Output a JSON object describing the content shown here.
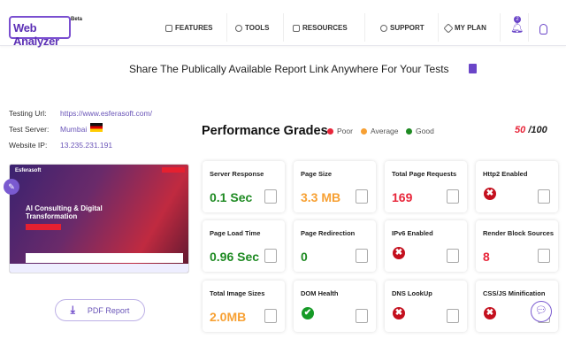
{
  "nav": {
    "logo": "Web Analyzer",
    "beta": "Beta",
    "items": [
      "FEATURES",
      "TOOLS",
      "RESOURCES",
      "SUPPORT",
      "MY PLAN"
    ],
    "notification_count": "2"
  },
  "share_text": "Share The Publically Available Report Link Anywhere For Your Tests",
  "info": {
    "url_label": "Testing Url:",
    "url": "https://www.esferasoft.com/",
    "server_label": "Test Server:",
    "server": "Mumbai",
    "ip_label": "Website IP:",
    "ip": "13.235.231.191"
  },
  "preview": {
    "brand": "Esferasoft",
    "headline": "AI Consulting & Digital Transformation"
  },
  "pdf_label": "PDF Report",
  "grades": {
    "title": "Performance Grades",
    "legend": [
      "Poor",
      "Average",
      "Good"
    ],
    "score": "50",
    "max": "/100"
  },
  "colors": {
    "poor": "#e8263a",
    "average": "#f7a033",
    "good": "#1e8a22",
    "accent": "#6a55b8"
  },
  "cards": [
    {
      "title": "Server Response",
      "value": "0.1 Sec",
      "status": "good"
    },
    {
      "title": "Page Size",
      "value": "3.3 MB",
      "status": "average"
    },
    {
      "title": "Total Page Requests",
      "value": "169",
      "status": "poor"
    },
    {
      "title": "Http2 Enabled",
      "value": "✖",
      "status": "fail"
    },
    {
      "title": "Page Load Time",
      "value": "0.96 Sec",
      "status": "good"
    },
    {
      "title": "Page Redirection",
      "value": "0",
      "status": "good"
    },
    {
      "title": "IPv6 Enabled",
      "value": "✖",
      "status": "fail"
    },
    {
      "title": "Render Block Sources",
      "value": "8",
      "status": "poor"
    },
    {
      "title": "Total Image Sizes",
      "value": "2.0MB",
      "status": "average"
    },
    {
      "title": "DOM Health",
      "value": "✔",
      "status": "pass"
    },
    {
      "title": "DNS LookUp",
      "value": "✖",
      "status": "fail"
    },
    {
      "title": "CSS/JS Minification",
      "value": "✖",
      "status": "fail"
    }
  ]
}
